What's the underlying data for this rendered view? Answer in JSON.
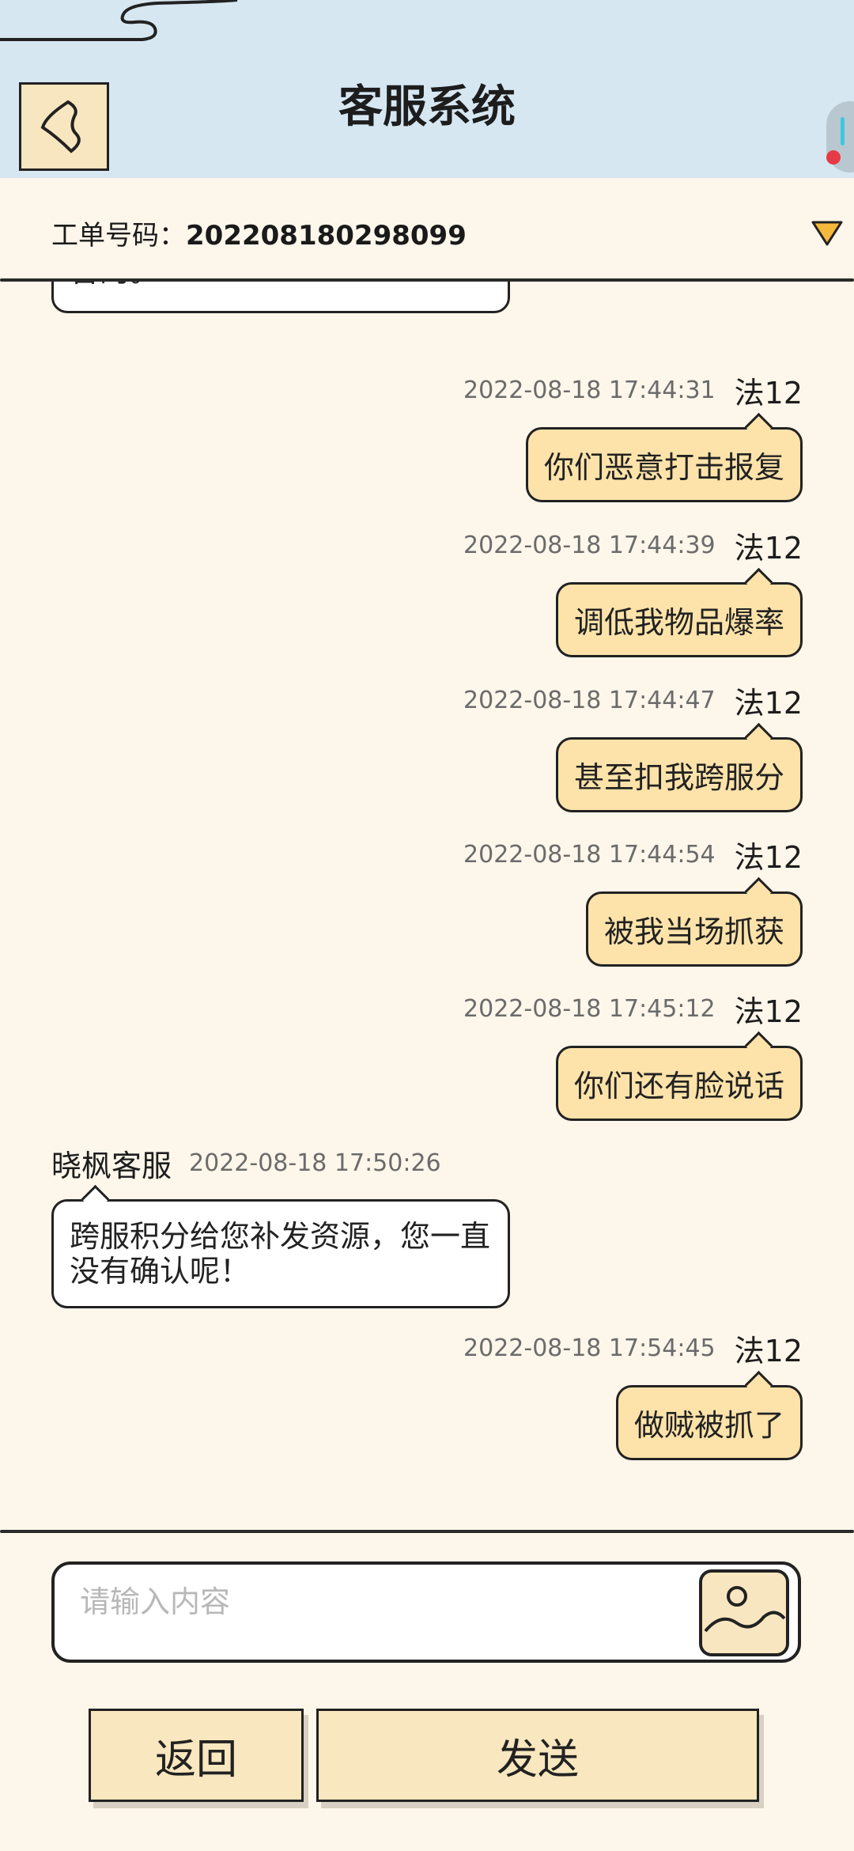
{
  "header": {
    "title": "客服系统"
  },
  "order": {
    "label": "工单号码：",
    "number": "202208180298099"
  },
  "messages": [
    {
      "from": "agent",
      "text": "言的。"
    },
    {
      "from": "me",
      "timestamp": "2022-08-18 17:44:31",
      "name": "法12",
      "text": "你们恶意打击报复"
    },
    {
      "from": "me",
      "timestamp": "2022-08-18 17:44:39",
      "name": "法12",
      "text": "调低我物品爆率"
    },
    {
      "from": "me",
      "timestamp": "2022-08-18 17:44:47",
      "name": "法12",
      "text": "甚至扣我跨服分"
    },
    {
      "from": "me",
      "timestamp": "2022-08-18 17:44:54",
      "name": "法12",
      "text": "被我当场抓获"
    },
    {
      "from": "me",
      "timestamp": "2022-08-18 17:45:12",
      "name": "法12",
      "text": "你们还有脸说话"
    },
    {
      "from": "agent",
      "name": "晓枫客服",
      "timestamp": "2022-08-18 17:50:26",
      "text": "跨服积分给您补发资源，您一直没有确认呢！"
    },
    {
      "from": "me",
      "timestamp": "2022-08-18 17:54:45",
      "name": "法12",
      "text": "做贼被抓了"
    }
  ],
  "input": {
    "placeholder": "请输入内容",
    "value": ""
  },
  "buttons": {
    "back": "返回",
    "send": "发送"
  },
  "colors": {
    "header_bg": "#d6e7f2",
    "page_bg": "#fdf6ea",
    "my_bubble": "#fde3aa",
    "button_bg": "#f8e7bf",
    "dropdown": "#f5b73c"
  },
  "icons": {
    "back": "back-arrow-icon",
    "dropdown": "triangle-down-icon",
    "image": "image-icon"
  }
}
